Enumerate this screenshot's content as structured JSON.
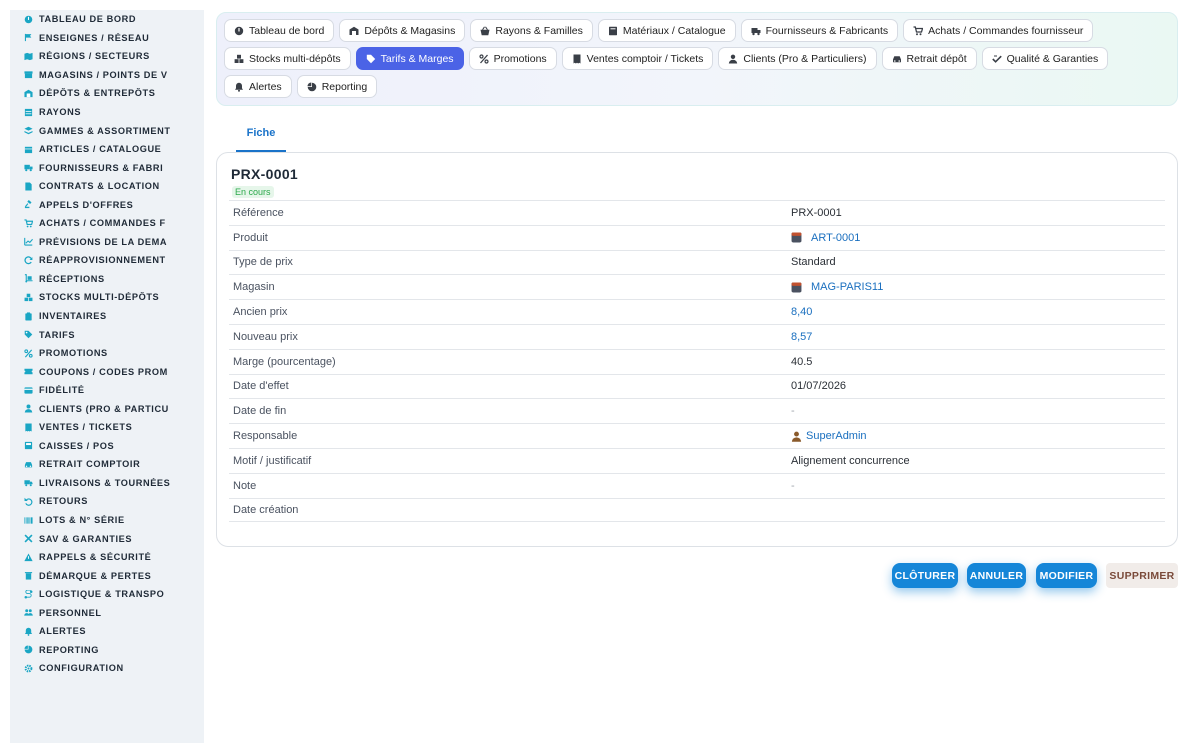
{
  "sidebar": {
    "items": [
      {
        "label": "TABLEAU DE BORD",
        "icon": "dashboard-icon"
      },
      {
        "label": "ENSEIGNES / RÉSEAU",
        "icon": "flag-icon"
      },
      {
        "label": "RÉGIONS / SECTEURS",
        "icon": "map-icon"
      },
      {
        "label": "MAGASINS / POINTS DE V",
        "icon": "store-icon"
      },
      {
        "label": "DÉPÔTS & ENTREPÔTS",
        "icon": "warehouse-icon"
      },
      {
        "label": "RAYONS",
        "icon": "shelf-icon"
      },
      {
        "label": "GAMMES & ASSORTIMENT",
        "icon": "layers-icon"
      },
      {
        "label": "ARTICLES / CATALOGUE",
        "icon": "box-icon"
      },
      {
        "label": "FOURNISSEURS & FABRI",
        "icon": "truck-icon"
      },
      {
        "label": "CONTRATS & LOCATION",
        "icon": "document-icon"
      },
      {
        "label": "APPELS D'OFFRES",
        "icon": "gavel-icon"
      },
      {
        "label": "ACHATS / COMMANDES F",
        "icon": "cart-icon"
      },
      {
        "label": "PRÉVISIONS DE LA DEMA",
        "icon": "chart-icon"
      },
      {
        "label": "RÉAPPROVISIONNEMENT",
        "icon": "refresh-icon"
      },
      {
        "label": "RÉCEPTIONS",
        "icon": "dolly-icon"
      },
      {
        "label": "STOCKS MULTI-DÉPÔTS",
        "icon": "boxes-icon"
      },
      {
        "label": "INVENTAIRES",
        "icon": "clipboard-icon"
      },
      {
        "label": "TARIFS",
        "icon": "tag-icon"
      },
      {
        "label": "PROMOTIONS",
        "icon": "percent-icon"
      },
      {
        "label": "COUPONS / CODES PROM",
        "icon": "ticket-icon"
      },
      {
        "label": "FIDÉLITÉ",
        "icon": "card-icon"
      },
      {
        "label": "CLIENTS (PRO & PARTICU",
        "icon": "user-icon"
      },
      {
        "label": "VENTES / TICKETS",
        "icon": "receipt-icon"
      },
      {
        "label": "CAISSES / POS",
        "icon": "register-icon"
      },
      {
        "label": "RETRAIT COMPTOIR",
        "icon": "car-icon"
      },
      {
        "label": "LIVRAISONS & TOURNÉES",
        "icon": "delivery-icon"
      },
      {
        "label": "RETOURS",
        "icon": "undo-icon"
      },
      {
        "label": "LOTS & N° SÉRIE",
        "icon": "barcode-icon"
      },
      {
        "label": "SAV & GARANTIES",
        "icon": "tools-icon"
      },
      {
        "label": "RAPPELS & SÉCURITÉ",
        "icon": "warning-icon"
      },
      {
        "label": "DÉMARQUE & PERTES",
        "icon": "trash-icon"
      },
      {
        "label": "LOGISTIQUE & TRANSPO",
        "icon": "route-icon"
      },
      {
        "label": "PERSONNEL",
        "icon": "users-icon"
      },
      {
        "label": "ALERTES",
        "icon": "bell-icon"
      },
      {
        "label": "REPORTING",
        "icon": "pie-icon"
      },
      {
        "label": "CONFIGURATION",
        "icon": "gear-icon"
      }
    ]
  },
  "tabs": [
    {
      "label": "Tableau de bord",
      "icon": "dashboard-icon",
      "active": false
    },
    {
      "label": "Dépôts & Magasins",
      "icon": "warehouse-icon",
      "active": false
    },
    {
      "label": "Rayons & Familles",
      "icon": "basket-icon",
      "active": false
    },
    {
      "label": "Matériaux / Catalogue",
      "icon": "catalog-icon",
      "active": false
    },
    {
      "label": "Fournisseurs & Fabricants",
      "icon": "truck-icon",
      "active": false
    },
    {
      "label": "Achats / Commandes fournisseur",
      "icon": "cart-icon",
      "active": false
    },
    {
      "label": "Stocks multi-dépôts",
      "icon": "boxes-icon",
      "active": false
    },
    {
      "label": "Tarifs & Marges",
      "icon": "tag-icon",
      "active": true
    },
    {
      "label": "Promotions",
      "icon": "percent-icon",
      "active": false
    },
    {
      "label": "Ventes comptoir / Tickets",
      "icon": "receipt-icon",
      "active": false
    },
    {
      "label": "Clients (Pro & Particuliers)",
      "icon": "user-icon",
      "active": false
    },
    {
      "label": "Retrait dépôt",
      "icon": "car-icon",
      "active": false
    },
    {
      "label": "Qualité & Garanties",
      "icon": "check-icon",
      "active": false
    },
    {
      "label": "Alertes",
      "icon": "bell-icon",
      "active": false
    },
    {
      "label": "Reporting",
      "icon": "pie-icon",
      "active": false
    }
  ],
  "subtab": {
    "label": "Fiche"
  },
  "record": {
    "title": "PRX-0001",
    "status": "En cours",
    "rows": [
      {
        "key": "Référence",
        "value": "PRX-0001",
        "kind": "text"
      },
      {
        "key": "Produit",
        "value": "ART-0001",
        "kind": "link-box"
      },
      {
        "key": "Type de prix",
        "value": "Standard",
        "kind": "text"
      },
      {
        "key": "Magasin",
        "value": "MAG-PARIS11",
        "kind": "link-box"
      },
      {
        "key": "Ancien prix",
        "value": "8,40",
        "kind": "num"
      },
      {
        "key": "Nouveau prix",
        "value": "8,57",
        "kind": "num"
      },
      {
        "key": "Marge (pourcentage)",
        "value": "40.5",
        "kind": "text"
      },
      {
        "key": "Date d'effet",
        "value": "01/07/2026",
        "kind": "text"
      },
      {
        "key": "Date de fin",
        "value": "-",
        "kind": "dash"
      },
      {
        "key": "Responsable",
        "value": "SuperAdmin",
        "kind": "link-user"
      },
      {
        "key": "Motif / justificatif",
        "value": "Alignement concurrence",
        "kind": "text"
      },
      {
        "key": "Note",
        "value": "-",
        "kind": "dash"
      },
      {
        "key": "Date création",
        "value": "",
        "kind": "text"
      }
    ]
  },
  "actions": {
    "close": "CLÔTURER",
    "cancel": "ANNULER",
    "edit": "MODIFIER",
    "delete": "SUPPRIMER"
  },
  "colors": {
    "accent": "#1586d8",
    "active_tab": "#4b63e6",
    "sidebar_icon": "#1aa6c4",
    "status_green": "#2aa84a"
  }
}
